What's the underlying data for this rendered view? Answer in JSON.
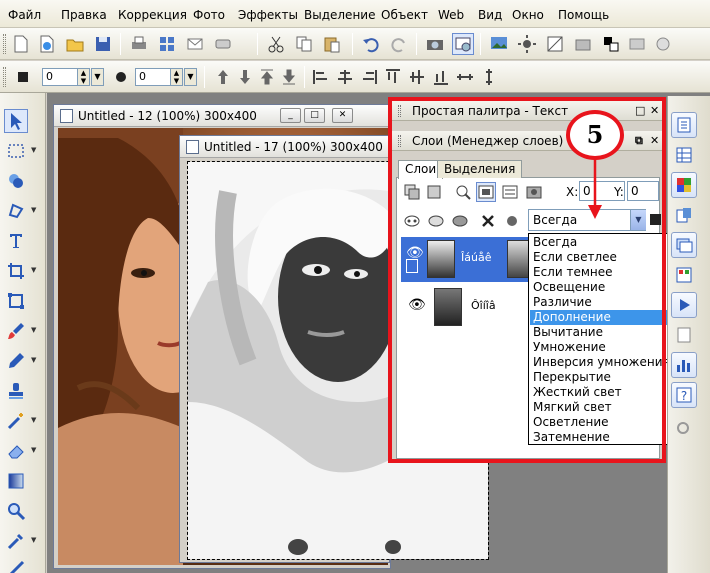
{
  "menu": {
    "items": [
      "Файл",
      "Правка",
      "Коррекция",
      "Фото",
      "Эффекты",
      "Выделение",
      "Объект",
      "Web",
      "Вид",
      "Окно",
      "Помощь"
    ]
  },
  "toolbar2": {
    "value1": "0",
    "value2": "0"
  },
  "docs": {
    "back_title": "Untitled - 12 (100%) 300x400",
    "front_title": "Untitled - 17 (100%) 300x400"
  },
  "panels": {
    "palette_title": "Простая палитра - Текст",
    "layers_title": "Слои (Менеджер слоев)",
    "tab_layers": "Слои",
    "tab_selections": "Выделения",
    "x_label": "X:",
    "x_value": "0",
    "y_label": "Y:",
    "y_value": "0"
  },
  "layers": [
    {
      "name": "Îáúåê"
    },
    {
      "name": "Ôîíîâ"
    }
  ],
  "blend": {
    "current": "Всегда",
    "options": [
      "Всегда",
      "Если светлее",
      "Если темнее",
      "Освещение",
      "Различие",
      "Дополнение",
      "Вычитание",
      "Умножение",
      "Инверсия умножения",
      "Перекрытие",
      "Жесткий свет",
      "Мягкий свет",
      "Осветление",
      "Затемнение"
    ],
    "selected_index": 5
  },
  "callout": {
    "number": "5"
  },
  "colors": {
    "highlight": "#e8141c",
    "selection": "#3d95ea",
    "layer_selected": "#3b6fd6"
  }
}
